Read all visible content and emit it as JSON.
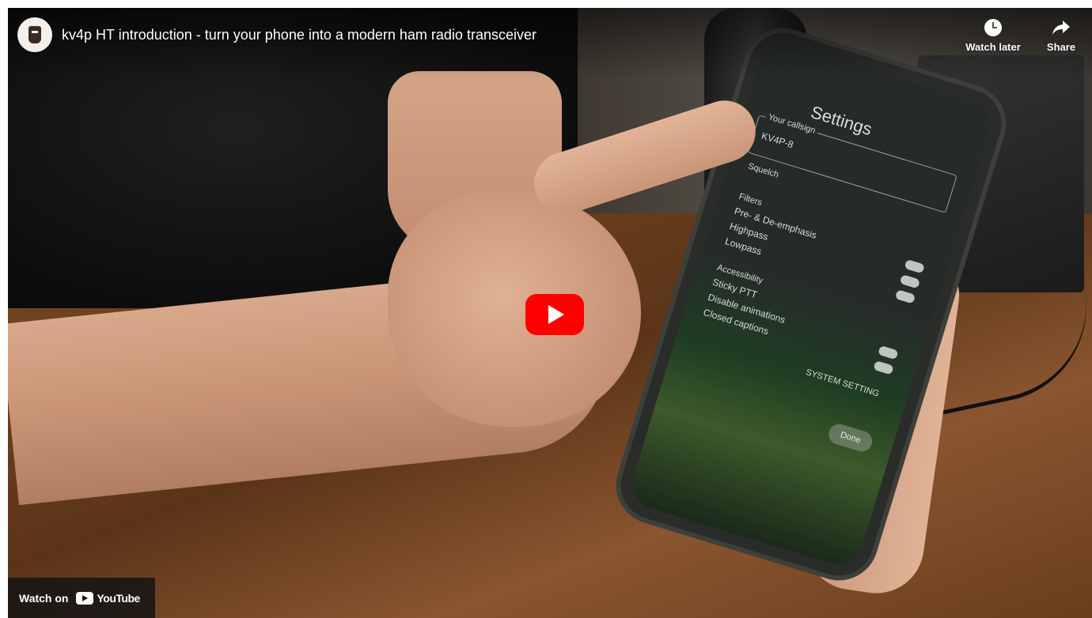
{
  "player": {
    "title": "kv4p HT introduction - turn your phone into a modern ham radio transceiver",
    "watch_later_label": "Watch later",
    "share_label": "Share",
    "watch_on_label": "Watch on",
    "youtube_label": "YouTube",
    "accent_color": "#ff0000"
  },
  "video_frame": {
    "phone_screen": {
      "title": "Settings",
      "callsign_label": "Your callsign",
      "callsign_value": "KV4P-8",
      "squelch_label": "Squelch",
      "filters_label": "Filters",
      "filter_rows": [
        "Pre- & De-emphasis",
        "Highpass",
        "Lowpass"
      ],
      "accessibility_label": "Accessibility",
      "accessibility_rows": [
        "Sticky PTT",
        "Disable animations",
        "Closed captions"
      ],
      "system_label": "SYSTEM SETTING",
      "done_label": "Done"
    }
  }
}
